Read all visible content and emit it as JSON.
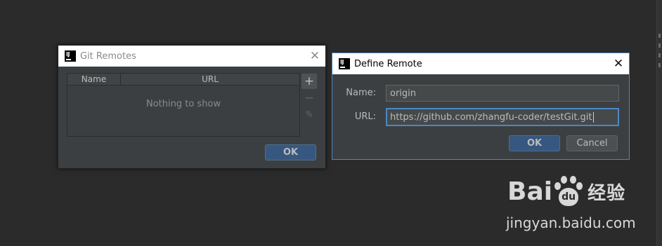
{
  "git_remotes_dialog": {
    "title": "Git Remotes",
    "icon_text": "IJ",
    "close_glyph": "✕",
    "columns": [
      "Name",
      "URL"
    ],
    "empty_text": "Nothing to show",
    "tools": {
      "add": "+",
      "remove": "−",
      "edit": "✎"
    },
    "ok_label": "OK"
  },
  "define_remote_dialog": {
    "title": "Define Remote",
    "icon_text": "IJ",
    "close_glyph": "✕",
    "name_label": "Name:",
    "name_value": "origin",
    "url_label": "URL:",
    "url_value": "https://github.com/zhangfu-coder/testGit.git",
    "ok_label": "OK",
    "cancel_label": "Cancel"
  },
  "watermark": {
    "logo_left": "Bai",
    "logo_paw": "du",
    "logo_cn": "经验",
    "url": "jingyan.baidu.com"
  },
  "colors": {
    "background": "#2b2b2b",
    "dialog": "#3c3f41",
    "focus_border": "#4a88c7",
    "ok_button": "#365880"
  }
}
